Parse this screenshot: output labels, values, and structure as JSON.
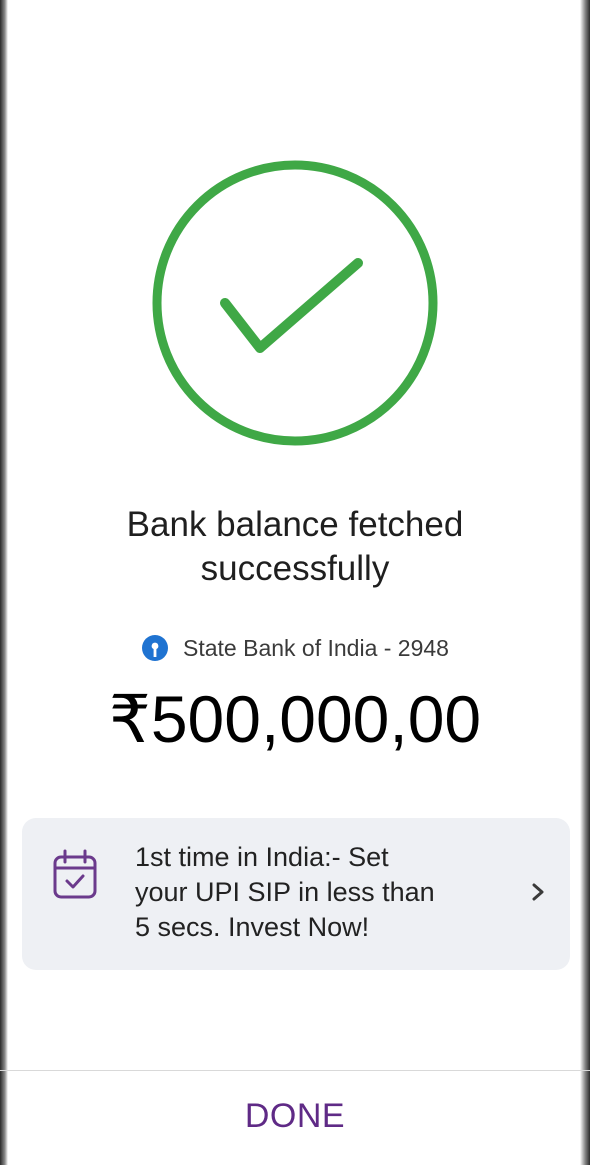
{
  "status": {
    "icon": "check-circle-icon",
    "title_line1": "Bank balance fetched",
    "title_line2": "successfully",
    "accent_color": "#3fa846"
  },
  "bank": {
    "icon": "sbi-logo-icon",
    "label": "State Bank of India - 2948",
    "logo_color": "#1f73d1"
  },
  "balance": {
    "amount": "₹500,000,00"
  },
  "promo": {
    "icon": "calendar-check-icon",
    "line1": "1st time in India:- Set",
    "line2": "your UPI SIP in less than",
    "line3": "5 secs. Invest Now!",
    "chevron_icon": "chevron-right-icon",
    "icon_color": "#6b3a8c",
    "background": "#eef0f4"
  },
  "footer": {
    "done_label": "DONE",
    "done_color": "#5f2a86"
  }
}
